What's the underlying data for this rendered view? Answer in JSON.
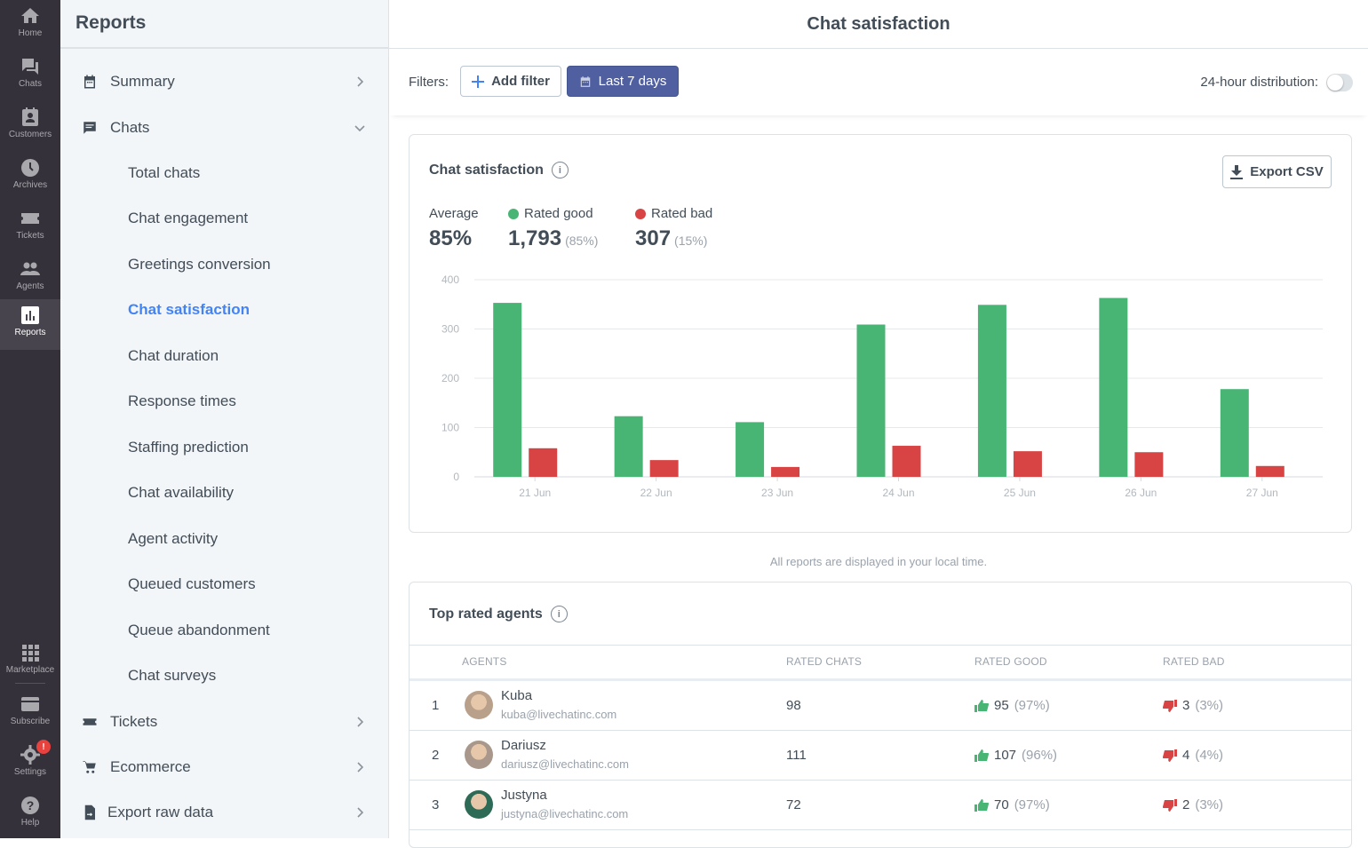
{
  "rail": {
    "items": [
      {
        "label": "Home",
        "icon": "home-icon"
      },
      {
        "label": "Chats",
        "icon": "chats-icon"
      },
      {
        "label": "Customers",
        "icon": "customers-icon"
      },
      {
        "label": "Archives",
        "icon": "clock-icon"
      },
      {
        "label": "Tickets",
        "icon": "ticket-icon"
      },
      {
        "label": "Agents",
        "icon": "agents-icon"
      },
      {
        "label": "Reports",
        "icon": "reports-icon",
        "active": true
      }
    ],
    "bottom": [
      {
        "label": "Marketplace",
        "icon": "grid-icon"
      },
      {
        "label": "Subscribe",
        "icon": "card-icon"
      },
      {
        "label": "Settings",
        "icon": "gear-icon",
        "badge": "!"
      },
      {
        "label": "Help",
        "icon": "help-icon"
      }
    ]
  },
  "sidebar": {
    "title": "Reports",
    "sections": [
      {
        "label": "Summary",
        "icon": "calendar-icon",
        "expanded": false
      },
      {
        "label": "Chats",
        "icon": "chat-icon",
        "expanded": true
      },
      {
        "label": "Tickets",
        "icon": "ticket-icon",
        "expanded": false
      },
      {
        "label": "Ecommerce",
        "icon": "cart-icon",
        "expanded": false
      },
      {
        "label": "Export raw data",
        "icon": "file-export-icon",
        "expanded": false
      }
    ],
    "chats_items": [
      "Total chats",
      "Chat engagement",
      "Greetings conversion",
      "Chat satisfaction",
      "Chat duration",
      "Response times",
      "Staffing prediction",
      "Chat availability",
      "Agent activity",
      "Queued customers",
      "Queue abandonment",
      "Chat surveys"
    ],
    "active_item": "Chat satisfaction"
  },
  "header": {
    "title": "Chat satisfaction"
  },
  "filters": {
    "label": "Filters:",
    "add_filter": "Add filter",
    "date_range": "Last 7 days",
    "distribution_label": "24-hour distribution:",
    "distribution_on": false
  },
  "satisfaction": {
    "title": "Chat satisfaction",
    "export": "Export CSV",
    "average_label": "Average",
    "average_value": "85%",
    "good_label": "Rated good",
    "good_value": "1,793",
    "good_pct": "(85%)",
    "bad_label": "Rated bad",
    "bad_value": "307",
    "bad_pct": "(15%)",
    "colors": {
      "good": "#48b575",
      "bad": "#d84444"
    }
  },
  "chart_data": {
    "type": "bar",
    "title": "",
    "xlabel": "",
    "ylabel": "",
    "categories": [
      "21 Jun",
      "22 Jun",
      "23 Jun",
      "24 Jun",
      "25 Jun",
      "26 Jun",
      "27 Jun"
    ],
    "series": [
      {
        "name": "Rated good",
        "color": "#48b575",
        "values": [
          353,
          123,
          111,
          309,
          349,
          363,
          178
        ]
      },
      {
        "name": "Rated bad",
        "color": "#d84444",
        "values": [
          58,
          34,
          20,
          63,
          52,
          50,
          22
        ]
      }
    ],
    "ylim": [
      0,
      400
    ],
    "yticks": [
      0,
      100,
      200,
      300,
      400
    ],
    "grid": true,
    "legend": "none"
  },
  "note": "All reports are displayed in your local time.",
  "agents": {
    "title": "Top rated agents",
    "columns": [
      "Agents",
      "Rated chats",
      "Rated good",
      "Rated bad"
    ],
    "rows": [
      {
        "rank": "1",
        "name": "Kuba",
        "email": "kuba@livechatinc.com",
        "rated": "98",
        "good": "95",
        "good_pct": "(97%)",
        "bad": "3",
        "bad_pct": "(3%)",
        "avatar_color": "#b9a08a"
      },
      {
        "rank": "2",
        "name": "Dariusz",
        "email": "dariusz@livechatinc.com",
        "rated": "111",
        "good": "107",
        "good_pct": "(96%)",
        "bad": "4",
        "bad_pct": "(4%)",
        "avatar_color": "#a8978a"
      },
      {
        "rank": "3",
        "name": "Justyna",
        "email": "justyna@livechatinc.com",
        "rated": "72",
        "good": "70",
        "good_pct": "(97%)",
        "bad": "2",
        "bad_pct": "(3%)",
        "avatar_color": "#2e6b57"
      }
    ]
  }
}
